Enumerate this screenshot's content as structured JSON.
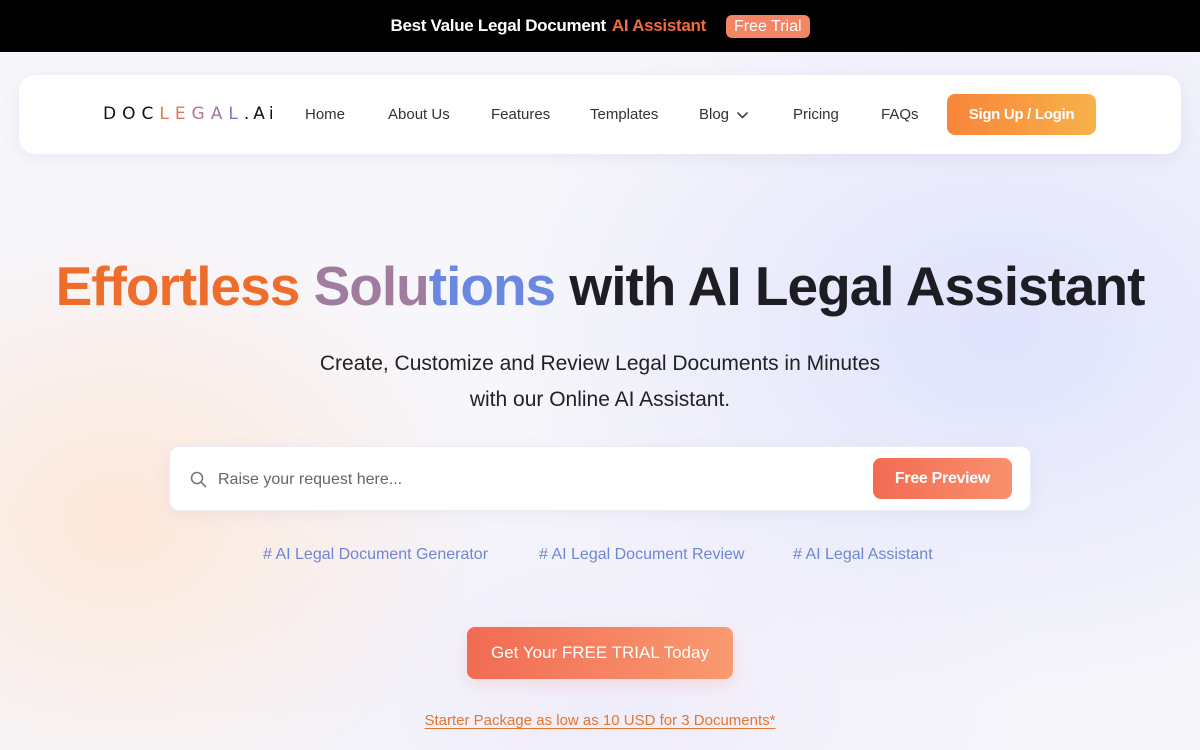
{
  "promo": {
    "text": "Best Value Legal Document",
    "accent": "AI Assistant",
    "badge": "Free Trial"
  },
  "logo": {
    "part1": "DOC",
    "part2": "LEGAL",
    "part3": ".Ai"
  },
  "nav": {
    "items": [
      {
        "label": "Home"
      },
      {
        "label": "About Us"
      },
      {
        "label": "Features"
      },
      {
        "label": "Templates"
      },
      {
        "label": "Blog"
      },
      {
        "label": "Pricing"
      },
      {
        "label": "FAQs"
      }
    ],
    "signup_label": "Sign Up / Login"
  },
  "hero": {
    "title_part1": "Effortless",
    "title_part2a": "Solu",
    "title_part2b": "tions",
    "title_part3": "with AI Legal Assistant",
    "subtitle_line1": "Create, Customize and Review Legal Documents in Minutes",
    "subtitle_line2": "with our Online AI Assistant."
  },
  "search": {
    "placeholder": "Raise your request here...",
    "value": "",
    "button_label": "Free Preview"
  },
  "tags": [
    "# AI Legal Document Generator",
    "# AI Legal Document Review",
    "# AI Legal Assistant"
  ],
  "cta": {
    "trial_label": "Get Your FREE TRIAL Today",
    "starter_text": "Starter Package as low as 10 USD for 3 Documents*"
  },
  "colors": {
    "accent_orange": "#f26a3d",
    "accent_blue": "#6d86d6",
    "text_dark": "#1d1d23"
  },
  "icons": {
    "search": "search-icon",
    "blog_dropdown": "chevron-down-icon"
  }
}
